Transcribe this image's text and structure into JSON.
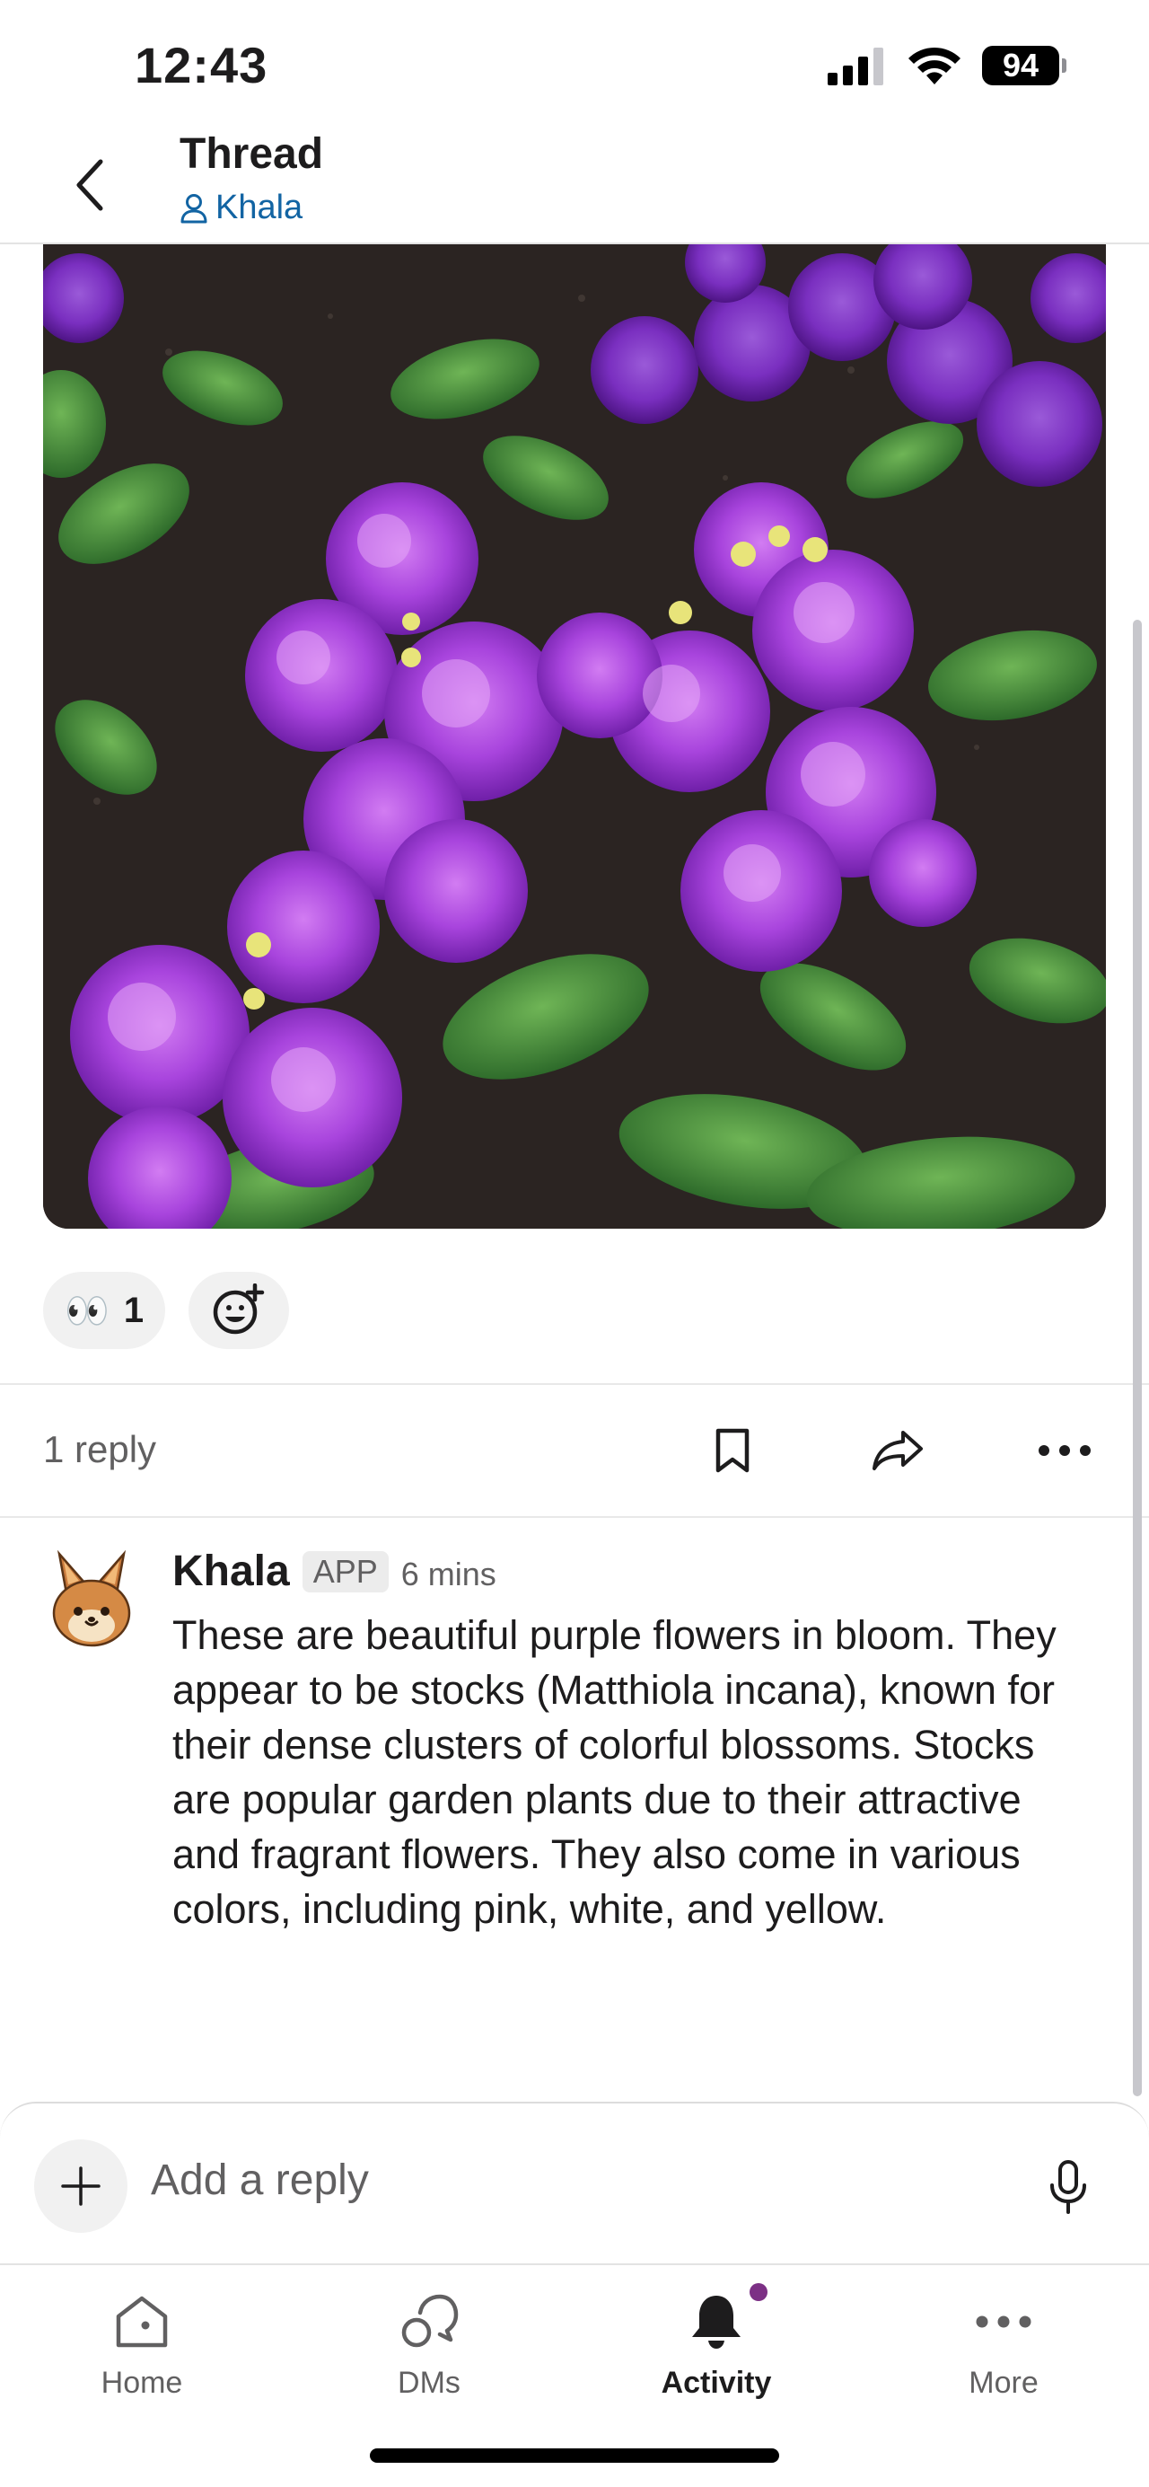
{
  "status_bar": {
    "time": "12:43",
    "battery": "94"
  },
  "header": {
    "title": "Thread",
    "subtitle": "Khala"
  },
  "reactions": {
    "emoji": "👀",
    "count": "1"
  },
  "thread": {
    "reply_count": "1 reply"
  },
  "message": {
    "author": "Khala",
    "badge": "APP",
    "time": "6 mins",
    "text": "These are beautiful purple flowers in bloom. They appear to be stocks (Matthiola incana), known for their dense clusters of colorful blossoms. Stocks are popular garden plants due to their attractive and fragrant flowers. They also come in various colors, including pink, white, and yellow."
  },
  "composer": {
    "placeholder": "Add a reply"
  },
  "tabs": [
    {
      "label": "Home"
    },
    {
      "label": "DMs"
    },
    {
      "label": "Activity"
    },
    {
      "label": "More"
    }
  ],
  "colors": {
    "link": "#1264a3",
    "flower": "#a944e0",
    "notification": "#7c3085"
  }
}
